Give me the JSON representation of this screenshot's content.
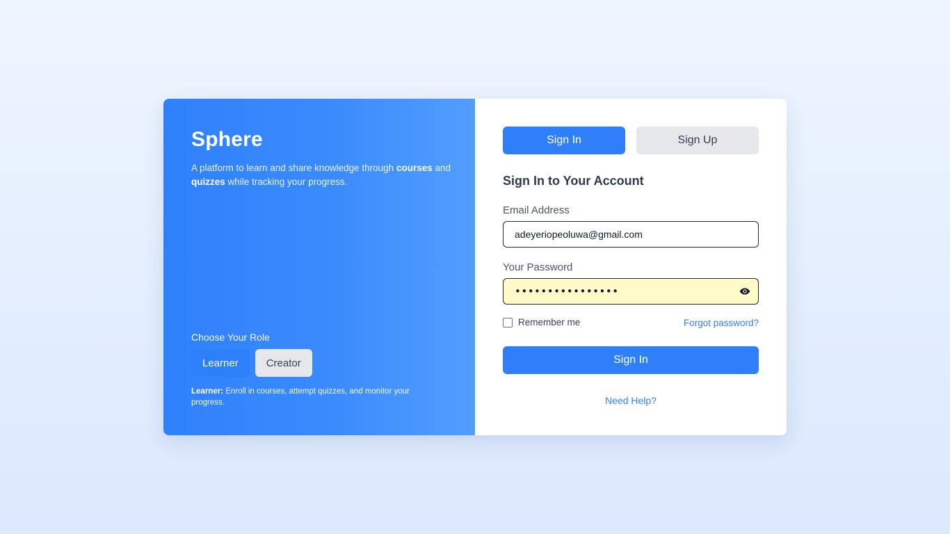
{
  "brand": {
    "name": "Sphere",
    "tagline_pre": "A platform to learn and share knowledge through ",
    "tagline_bold1": "courses",
    "tagline_mid": " and ",
    "tagline_bold2": "quizzes",
    "tagline_post": " while tracking your progress."
  },
  "role": {
    "title": "Choose Your Role",
    "options": [
      "Learner",
      "Creator"
    ],
    "selected": "Learner",
    "desc_bold": "Learner:",
    "desc": " Enroll in courses, attempt quizzes, and monitor your progress."
  },
  "tabs": [
    {
      "label": "Sign In",
      "active": true
    },
    {
      "label": "Sign Up",
      "active": false
    }
  ],
  "form": {
    "title": "Sign In to Your Account",
    "email_label": "Email Address",
    "email_value": "adeyeriopeoluwa@gmail.com",
    "password_label": "Your Password",
    "password_masked": "••••••••••••••••",
    "remember_label": "Remember me",
    "remember_checked": false,
    "forgot_label": "Forgot password?",
    "submit_label": "Sign In",
    "help_label": "Need Help?"
  },
  "colors": {
    "accent": "#2f7ffb",
    "password_fill": "#fefbc8"
  },
  "icons": {
    "password_toggle": "eye-icon"
  }
}
